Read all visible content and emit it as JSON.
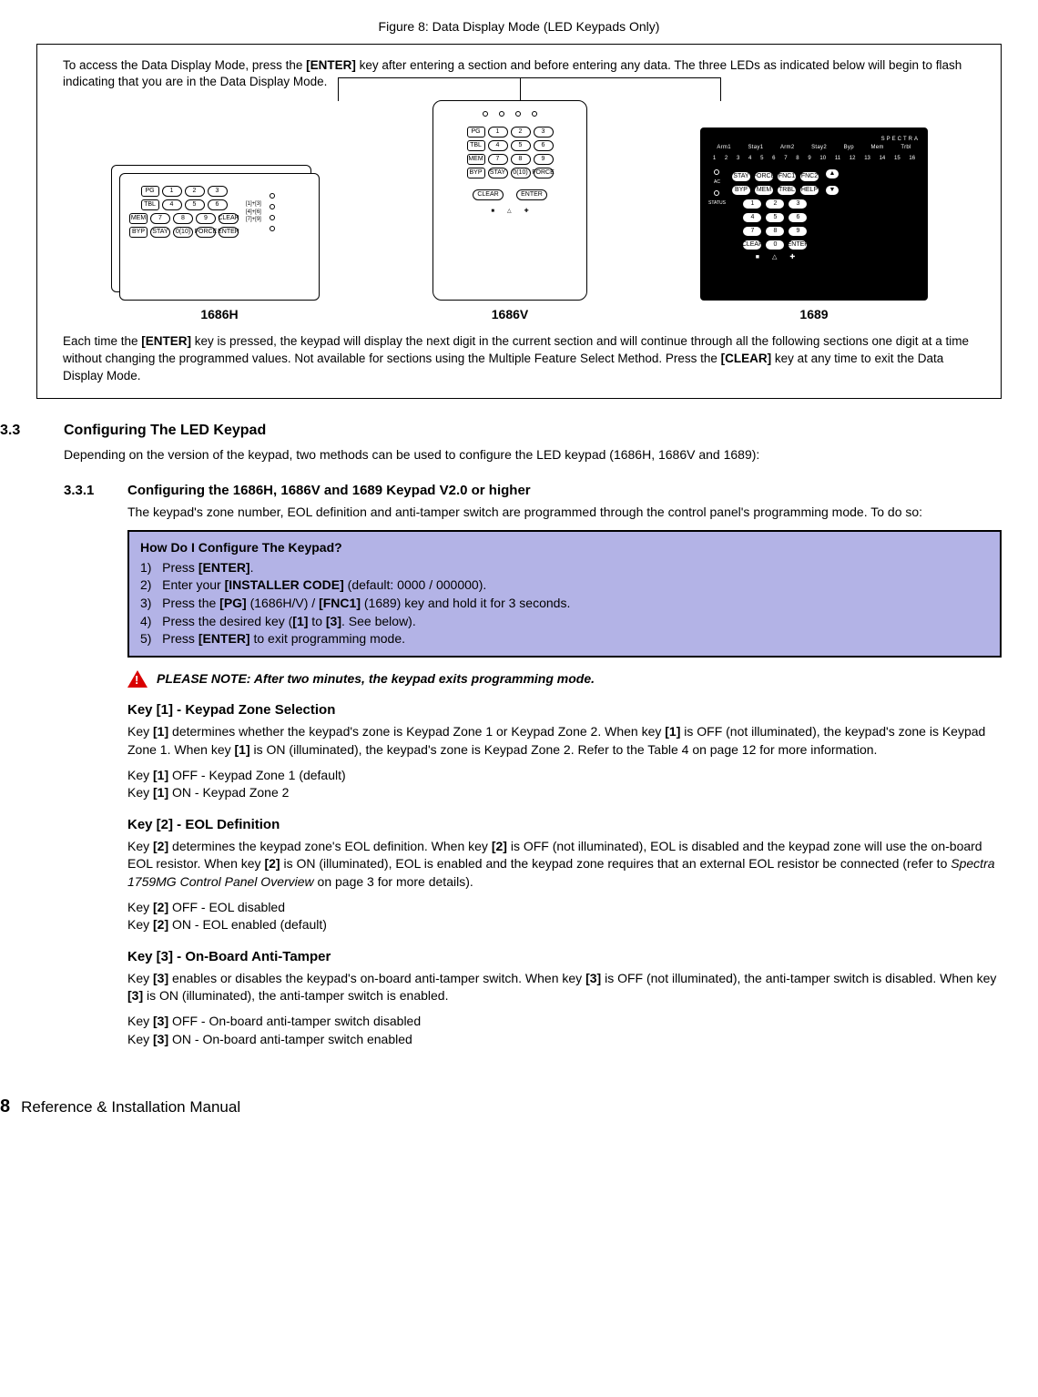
{
  "figure": {
    "caption": "Figure 8: Data Display Mode (LED Keypads Only)",
    "intro_parts": [
      "To access the Data Display Mode, press the ",
      "[ENTER]",
      " key after entering a section and before entering any data. The three LEDs as indicated below will begin to flash indicating that you are in the Data Display Mode."
    ],
    "keypad_labels": {
      "left": "1686H",
      "mid": "1686V",
      "right": "1689"
    },
    "outro_parts": [
      "Each time the ",
      "[ENTER]",
      " key is pressed, the keypad will display the next digit in the current section and will continue through all the following sections one digit at a time without changing the programmed values. Not available for sections using the Multiple Feature Select Method. Press the ",
      "[CLEAR]",
      " key at any time to exit the Data Display Mode."
    ],
    "kp_h": {
      "left_col": [
        "PG",
        "TBL",
        "MEM",
        "BYP"
      ],
      "num_rows": [
        [
          "1",
          "2",
          "3"
        ],
        [
          "4",
          "5",
          "6"
        ],
        [
          "7",
          "8",
          "9"
        ],
        [
          "STAY",
          "0(10)",
          "FORCE",
          "ENTER"
        ]
      ],
      "right_labels": [
        "[1]+[3]",
        "[4]+[6]",
        "[7]+[9]"
      ],
      "clear": "CLEAR"
    },
    "kp_v": {
      "left_col": [
        "PG",
        "TBL",
        "MEM",
        "BYP"
      ],
      "num_rows": [
        [
          "1",
          "2",
          "3"
        ],
        [
          "4",
          "5",
          "6"
        ],
        [
          "7",
          "8",
          "9"
        ],
        [
          "STAY",
          "0(10)",
          "FORCE"
        ]
      ],
      "bottom": [
        "CLEAR",
        "ENTER"
      ]
    },
    "kp_b": {
      "brand": "SPECTRA",
      "hdr": [
        "Arm1",
        "Stay1",
        "Arm2",
        "Stay2",
        "Byp",
        "Mem",
        "Trbl"
      ],
      "nums": [
        "1",
        "2",
        "3",
        "4",
        "5",
        "6",
        "7",
        "8",
        "9",
        "10",
        "11",
        "12",
        "13",
        "14",
        "15",
        "16"
      ],
      "side": [
        "AC",
        "STATUS"
      ],
      "fn_row1": [
        "STAY",
        "FORCE",
        "FNC1",
        "FNC2"
      ],
      "fn_row2": [
        "BYP",
        "MEM",
        "TRBL",
        "HELP"
      ],
      "num_rows": [
        [
          "1",
          "2",
          "3"
        ],
        [
          "4",
          "5",
          "6"
        ],
        [
          "7",
          "8",
          "9"
        ],
        [
          "CLEAR",
          "0",
          "ENTER"
        ]
      ],
      "arrows": [
        "▲",
        "▼"
      ]
    }
  },
  "s33": {
    "num": "3.3",
    "title": "Configuring The LED Keypad",
    "body": "Depending on the version of the keypad, two methods can be used to configure the LED keypad (1686H, 1686V and 1689):"
  },
  "s331": {
    "num": "3.3.1",
    "title": "Configuring the 1686H, 1686V and 1689 Keypad V2.0 or higher",
    "intro": "The keypad's zone number, EOL definition and anti-tamper switch are programmed through the control panel's programming mode. To do so:",
    "howto": {
      "title": "How Do I Configure The Keypad?",
      "steps": [
        {
          "n": "1)",
          "pre": "Press ",
          "k1": "[ENTER]",
          "post": "."
        },
        {
          "n": "2)",
          "pre": "Enter your ",
          "k1": "[INSTALLER CODE]",
          "post": " (default: 0000 / 000000)."
        },
        {
          "n": "3)",
          "pre": "Press the ",
          "k1": "[PG]",
          "mid": " (1686H/V) / ",
          "k2": "[FNC1]",
          "post": " (1689) key and hold it for 3 seconds."
        },
        {
          "n": "4)",
          "pre": "Press the desired key (",
          "k1": "[1]",
          "mid": " to ",
          "k2": "[3]",
          "post": ". See below)."
        },
        {
          "n": "5)",
          "pre": "Press ",
          "k1": "[ENTER]",
          "post": " to exit programming mode."
        }
      ]
    },
    "note": "PLEASE NOTE: After two minutes, the keypad exits programming mode.",
    "key1": {
      "title": "Key [1] - Keypad Zone Selection",
      "p": [
        "Key ",
        "[1]",
        " determines whether the keypad's zone is Keypad Zone 1 or Keypad Zone 2. When key ",
        "[1]",
        " is OFF (not illuminated), the keypad's zone is Keypad Zone 1. When key ",
        "[1]",
        " is ON (illuminated), the keypad's zone is Keypad Zone 2. Refer to the Table 4 on page 12 for more information."
      ],
      "off": [
        "Key ",
        "[1]",
        " OFF - Keypad Zone 1 (default)"
      ],
      "on": [
        "Key ",
        "[1]",
        " ON - Keypad Zone 2"
      ]
    },
    "key2": {
      "title": "Key [2] - EOL Definition",
      "p_pre": [
        "Key ",
        "[2]",
        " determines the keypad zone's EOL definition. When key ",
        "[2]",
        " is OFF (not illuminated), EOL is disabled and the keypad zone will use the on-board EOL resistor. When key ",
        "[2]",
        " is ON (illuminated), EOL is enabled and the keypad zone requires that an external EOL resistor be connected (refer to "
      ],
      "p_ital": "Spectra 1759MG Control Panel Overview",
      "p_post": " on page 3 for more details).",
      "off": [
        "Key ",
        "[2]",
        " OFF - EOL disabled"
      ],
      "on": [
        "Key ",
        "[2]",
        " ON - EOL enabled (default)"
      ]
    },
    "key3": {
      "title": "Key [3] - On-Board Anti-Tamper",
      "p": [
        "Key ",
        "[3]",
        " enables or disables the keypad's on-board anti-tamper switch. When key ",
        "[3]",
        " is OFF (not illuminated), the anti-tamper switch is disabled. When key ",
        "[3]",
        " is ON (illuminated), the anti-tamper switch is enabled."
      ],
      "off": [
        "Key ",
        "[3]",
        " OFF - On-board anti-tamper switch disabled"
      ],
      "on": [
        "Key ",
        "[3]",
        " ON - On-board anti-tamper switch enabled"
      ]
    }
  },
  "footer": {
    "page": "8",
    "text": "Reference & Installation Manual"
  }
}
